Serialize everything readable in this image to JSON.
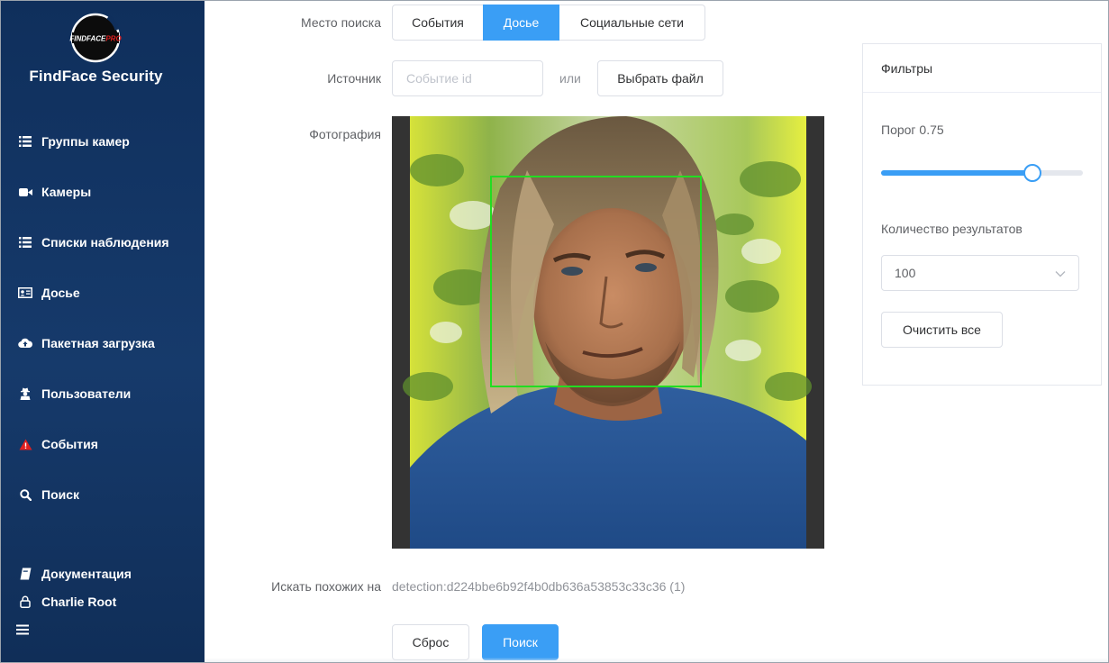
{
  "sidebar": {
    "logo_text": "FINDFACEPRO",
    "brand": "FindFace Security",
    "items": [
      {
        "label": "Группы камер",
        "icon": "list-icon"
      },
      {
        "label": "Камеры",
        "icon": "video-camera-icon"
      },
      {
        "label": "Списки наблюдения",
        "icon": "list-icon"
      },
      {
        "label": "Досье",
        "icon": "id-card-icon"
      },
      {
        "label": "Пакетная загрузка",
        "icon": "cloud-upload-icon"
      },
      {
        "label": "Пользователи",
        "icon": "user-secret-icon"
      },
      {
        "label": "События",
        "icon": "warning-icon"
      },
      {
        "label": "Поиск",
        "icon": "search-icon"
      }
    ],
    "bottom": {
      "docs": "Документация",
      "user": "Charlie Root"
    },
    "colors": {
      "warning": "#e02020",
      "background": "#143868"
    }
  },
  "form": {
    "search_place_label": "Место поиска",
    "tabs": [
      "События",
      "Досье",
      "Социальные сети"
    ],
    "active_tab": "Досье",
    "source_label": "Источник",
    "source_placeholder": "Событие id",
    "or_label": "или",
    "choose_file_button": "Выбрать файл",
    "photo_label": "Фотография",
    "similar_label": "Искать похожих на",
    "similar_value": "detection:d224bbe6b92f4b0db636a53853c33c36 (1)",
    "reset_button": "Сброс",
    "search_button": "Поиск"
  },
  "filters": {
    "title": "Фильтры",
    "threshold_label": "Порог 0.75",
    "threshold_value": 0.75,
    "results_label": "Количество результатов",
    "results_value": "100",
    "clear_button": "Очистить все"
  },
  "colors": {
    "accent": "#3a9ef5",
    "face_box": "#22dd22"
  }
}
